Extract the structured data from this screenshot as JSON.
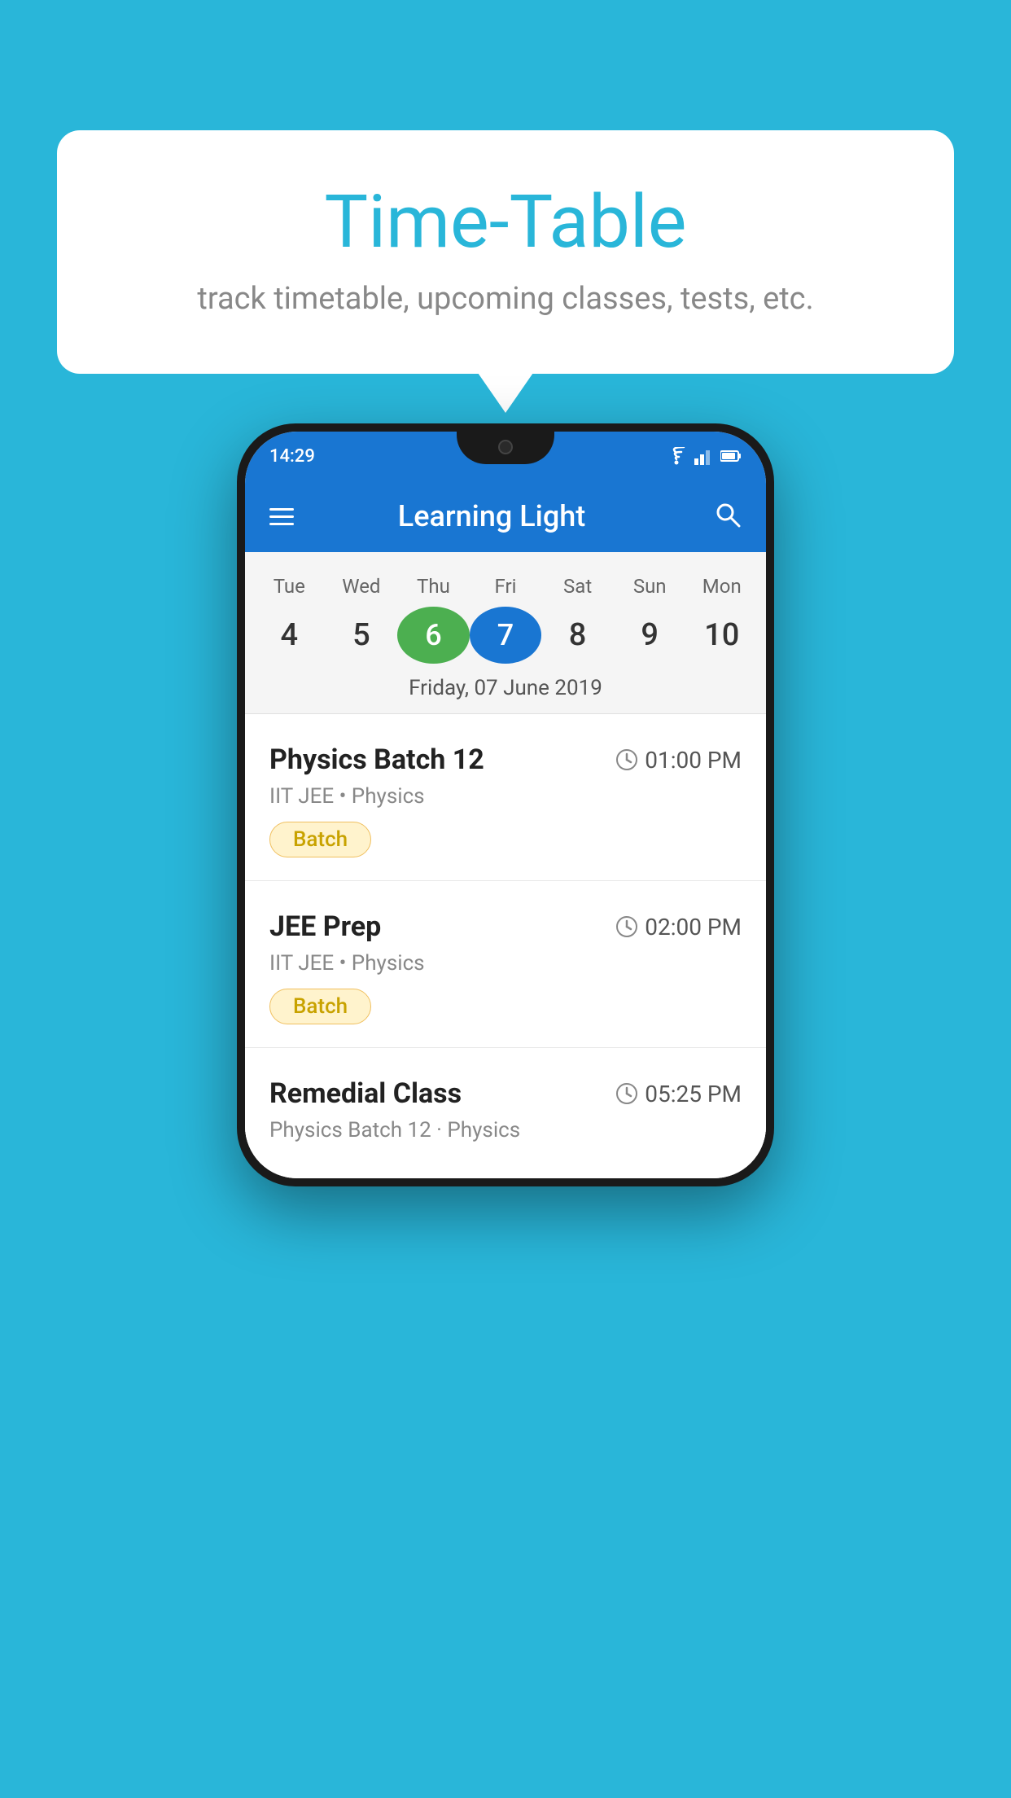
{
  "background_color": "#29B6D9",
  "tooltip": {
    "title": "Time-Table",
    "subtitle": "track timetable, upcoming classes, tests, etc."
  },
  "phone": {
    "status_bar": {
      "time": "14:29"
    },
    "app_bar": {
      "title": "Learning Light"
    },
    "calendar": {
      "days": [
        {
          "label": "Tue",
          "number": "4",
          "state": "normal"
        },
        {
          "label": "Wed",
          "number": "5",
          "state": "normal"
        },
        {
          "label": "Thu",
          "number": "6",
          "state": "today"
        },
        {
          "label": "Fri",
          "number": "7",
          "state": "selected"
        },
        {
          "label": "Sat",
          "number": "8",
          "state": "normal"
        },
        {
          "label": "Sun",
          "number": "9",
          "state": "normal"
        },
        {
          "label": "Mon",
          "number": "10",
          "state": "normal"
        }
      ],
      "selected_date_label": "Friday, 07 June 2019"
    },
    "schedule_items": [
      {
        "title": "Physics Batch 12",
        "time": "01:00 PM",
        "subtitle": "IIT JEE • Physics",
        "badge": "Batch"
      },
      {
        "title": "JEE Prep",
        "time": "02:00 PM",
        "subtitle": "IIT JEE • Physics",
        "badge": "Batch"
      },
      {
        "title": "Remedial Class",
        "time": "05:25 PM",
        "subtitle": "Physics Batch 12 · Physics",
        "badge": null
      }
    ]
  }
}
